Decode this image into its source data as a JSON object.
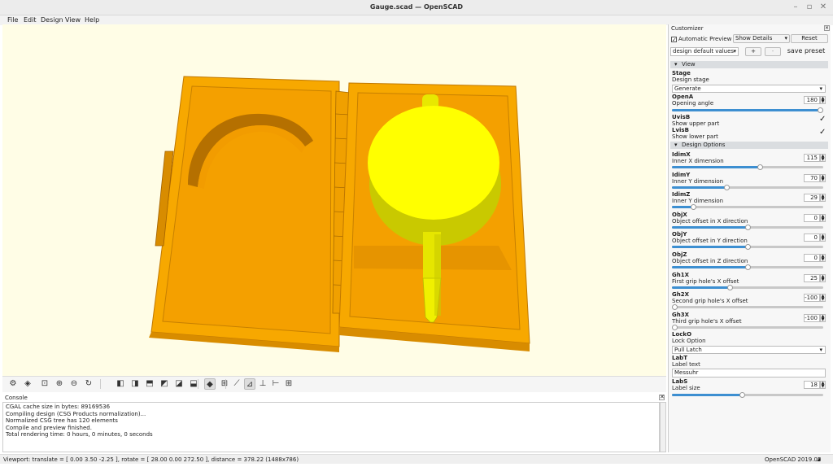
{
  "window": {
    "title": "Gauge.scad — OpenSCAD",
    "controls": [
      "–",
      "▫",
      "✕"
    ]
  },
  "menu": [
    "File",
    "Edit",
    "Design",
    "View",
    "Help"
  ],
  "toolbar": {
    "icons": [
      "render-icon",
      "preview-icon",
      "zoom-all-icon",
      "zoom-in-icon",
      "zoom-out-icon",
      "reset-view-icon",
      "view-right-icon",
      "view-top-icon",
      "view-bottom-icon",
      "view-left-icon",
      "view-front-icon",
      "view-back-icon",
      "diagonal-view-icon",
      "view-center-icon",
      "perspective-icon",
      "orthogonal-icon",
      "show-axes-icon",
      "show-scale-icon",
      "show-edges-icon"
    ]
  },
  "console": {
    "title": "Console",
    "lines": [
      "CGAL cache size in bytes: 89169536",
      "Compiling design (CSG Products normalization)...",
      "Normalized CSG tree has 120 elements",
      "Compile and preview finished.",
      "Total rendering time: 0 hours, 0 minutes, 0 seconds"
    ]
  },
  "status": {
    "viewport": "Viewport: translate = [ 0.00 3.50 -2.25 ], rotate = [ 28.00 0.00 272.50 ], distance = 378.22 (1488x786)",
    "version": "OpenSCAD 2019.05"
  },
  "customizer": {
    "title": "Customizer",
    "auto_preview": "Automatic Preview",
    "show_details": "Show Details",
    "reset": "Reset",
    "preset": "design default values",
    "plus": "+",
    "minus": "-",
    "save_preset": "save preset",
    "sections": [
      "View",
      "Design Options"
    ],
    "stage": {
      "name": "Stage",
      "desc": "Design stage",
      "value": "Generate"
    },
    "openA": {
      "name": "OpenA",
      "desc": "Opening angle",
      "value": "180",
      "level": 1.0
    },
    "uvisb": {
      "name": "UvisB",
      "desc": "Show upper part",
      "checked": "✓"
    },
    "lvisb": {
      "name": "LvisB",
      "desc": "Show lower part",
      "checked": "✓"
    },
    "params": [
      {
        "name": "IdimX",
        "desc": "Inner X dimension",
        "value": "115",
        "level": 0.58
      },
      {
        "name": "IdimY",
        "desc": "Inner Y dimension",
        "value": "70",
        "level": 0.36
      },
      {
        "name": "IdimZ",
        "desc": "Inner Y dimension",
        "value": "29",
        "level": 0.14
      },
      {
        "name": "ObjX",
        "desc": "Object offset in X direction",
        "value": "0",
        "level": 0.5
      },
      {
        "name": "ObjY",
        "desc": "Object offset in Y direction",
        "value": "0",
        "level": 0.5
      },
      {
        "name": "ObjZ",
        "desc": "Object offset in Z direction",
        "value": "0",
        "level": 0.5
      },
      {
        "name": "Gh1X",
        "desc": "First grip hole's X offset",
        "value": "25",
        "level": 0.38
      },
      {
        "name": "Gh2X",
        "desc": "Second grip hole's X offset",
        "value": "-100",
        "level": 0.0
      },
      {
        "name": "Gh3X",
        "desc": "Third grip hole's X offset",
        "value": "-100",
        "level": 0.0
      }
    ],
    "lock": {
      "name": "LockO",
      "desc": "Lock Option",
      "value": "Pull Latch"
    },
    "labt": {
      "name": "LabT",
      "desc": "Label text",
      "value": "Messuhr"
    },
    "labs": {
      "name": "LabS",
      "desc": "Label size",
      "value": "18",
      "level": 0.46
    }
  },
  "colors": {
    "model": "#f7a800",
    "model_shadow": "#d88c00",
    "gauge": "#ffff00",
    "gauge_shadow": "#d8d800",
    "background": "#fffde6",
    "accent": "#3d8fd1"
  }
}
